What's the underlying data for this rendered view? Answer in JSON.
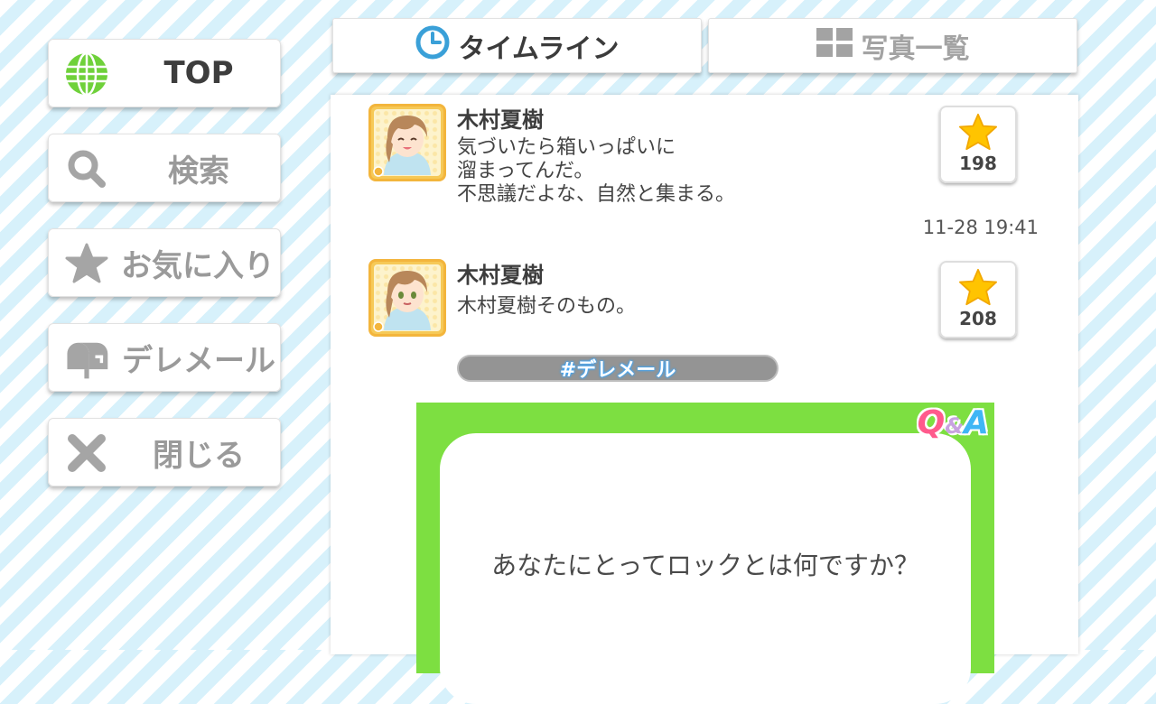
{
  "sidebar": {
    "items": [
      {
        "label": "TOP",
        "icon": "globe-icon",
        "active": true
      },
      {
        "label": "検索",
        "icon": "search-icon",
        "active": false
      },
      {
        "label": "お気に入り",
        "icon": "star-icon",
        "active": false
      },
      {
        "label": "デレメール",
        "icon": "mailbox-icon",
        "active": false
      },
      {
        "label": "閉じる",
        "icon": "close-icon",
        "active": false
      }
    ]
  },
  "tabs": [
    {
      "label": "タイムライン",
      "icon": "clock-icon",
      "active": true
    },
    {
      "label": "写真一覧",
      "icon": "grid-icon",
      "active": false
    }
  ],
  "posts": [
    {
      "author": "木村夏樹",
      "message": "気づいたら箱いっぱいに\n溜まってんだ。\n不思議だよな、自然と集まる。",
      "likes": "198",
      "timestamp": "11-28 19:41"
    },
    {
      "author": "木村夏樹",
      "message": "木村夏樹そのもの。",
      "likes": "208",
      "hashtag": "#デレメール",
      "qa": {
        "logo_q": "Q",
        "logo_amp": "&",
        "logo_a": "A",
        "question": "あなたにとってロックとは何ですか？"
      }
    }
  ],
  "colors": {
    "accent_blue": "#3aa0d8",
    "qa_green": "#7ddf41",
    "star_yellow": "#ffc400",
    "avatar_frame": "#f6c957"
  }
}
